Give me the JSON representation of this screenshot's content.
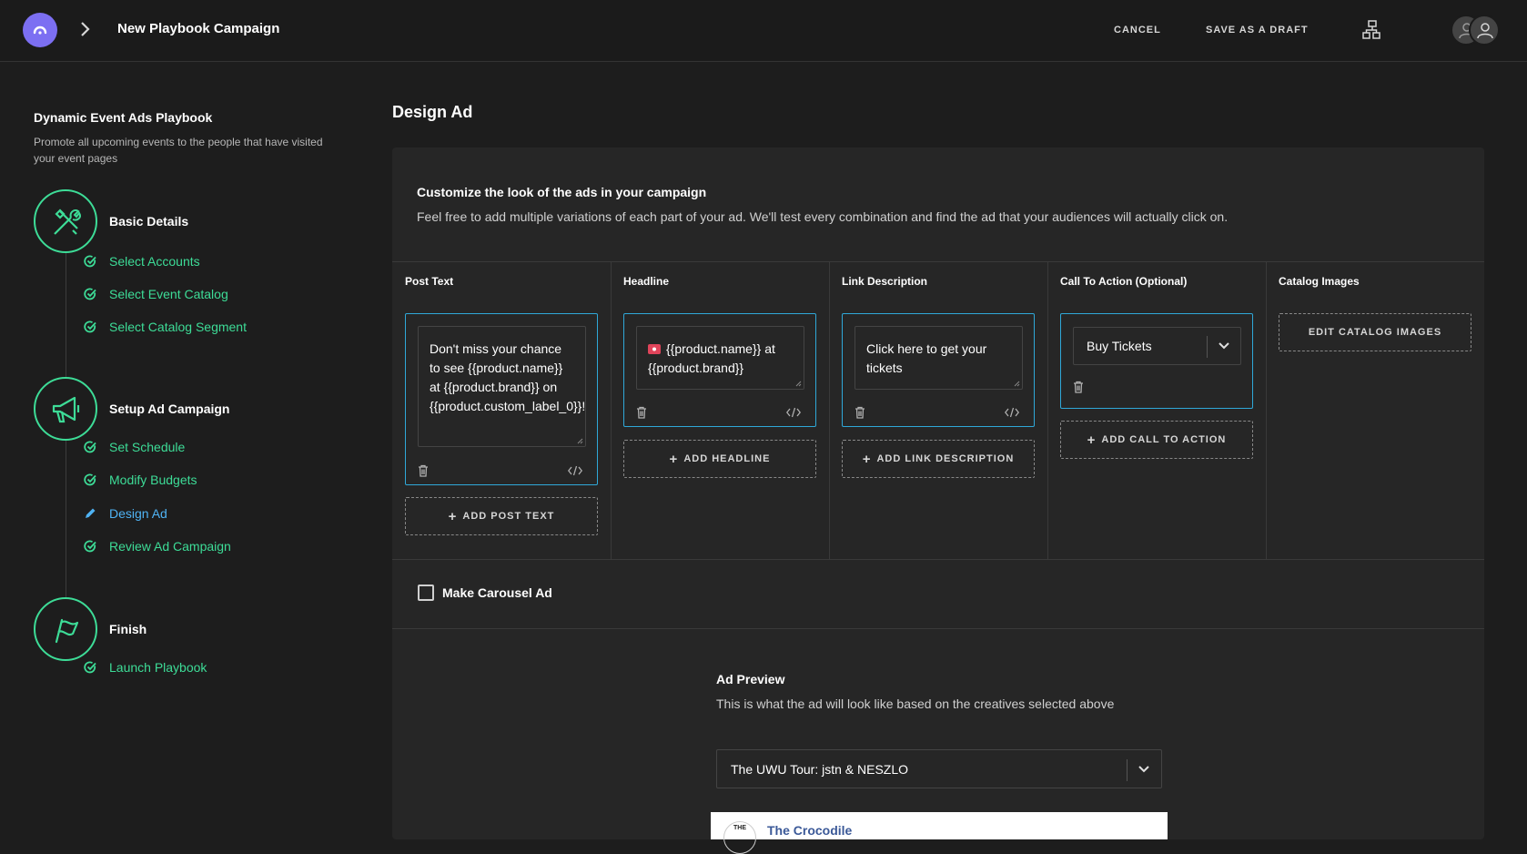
{
  "header": {
    "title": "New Playbook Campaign",
    "cancel_label": "CANCEL",
    "draft_label": "SAVE AS A DRAFT"
  },
  "sidebar": {
    "playbook_title": "Dynamic Event Ads Playbook",
    "playbook_desc": "Promote all upcoming events to the people that have visited your event pages",
    "steps": [
      {
        "title": "Basic Details",
        "icon": "tools-icon",
        "items": [
          {
            "label": "Select Accounts",
            "status": "done"
          },
          {
            "label": "Select Event Catalog",
            "status": "done"
          },
          {
            "label": "Select Catalog Segment",
            "status": "done"
          }
        ]
      },
      {
        "title": "Setup Ad Campaign",
        "icon": "megaphone-icon",
        "items": [
          {
            "label": "Set Schedule",
            "status": "done"
          },
          {
            "label": "Modify Budgets",
            "status": "done"
          },
          {
            "label": "Design Ad",
            "status": "editing"
          },
          {
            "label": "Review Ad Campaign",
            "status": "done"
          }
        ]
      },
      {
        "title": "Finish",
        "icon": "flag-icon",
        "items": [
          {
            "label": "Launch Playbook",
            "status": "done"
          }
        ]
      }
    ]
  },
  "main": {
    "title": "Design Ad",
    "card_title": "Customize the look of the ads in your campaign",
    "card_desc": "Feel free to add multiple variations of each part of your ad. We'll test every combination and find the ad that your audiences will actually click on.",
    "columns": {
      "post_text": {
        "header": "Post Text",
        "value": "Don't miss your chance to see {{product.name}} at {{product.brand}} on {{product.custom_label_0}}!",
        "add_label": "ADD POST TEXT"
      },
      "headline": {
        "header": "Headline",
        "value": "{{product.name}} at {{product.brand}}",
        "emoji": "ticket",
        "add_label": "ADD HEADLINE"
      },
      "link_description": {
        "header": "Link Description",
        "value": "Click here to get your tickets",
        "add_label": "ADD LINK DESCRIPTION"
      },
      "call_to_action": {
        "header": "Call To Action (Optional)",
        "value": "Buy Tickets",
        "add_label": "ADD CALL TO ACTION"
      },
      "catalog_images": {
        "header": "Catalog Images",
        "edit_label": "EDIT CATALOG IMAGES"
      }
    },
    "carousel_label": "Make Carousel Ad",
    "carousel_checked": false,
    "preview": {
      "title": "Ad Preview",
      "desc": "This is what the ad will look like based on the creatives selected above",
      "selected_event": "The UWU Tour: jstn & NESZLO",
      "page_name": "The Crocodile",
      "logo_text": "THE"
    }
  },
  "colors": {
    "accent_green": "#3ddc97",
    "accent_blue": "#2fa8d8",
    "brand_purple": "#7c6ff2"
  }
}
